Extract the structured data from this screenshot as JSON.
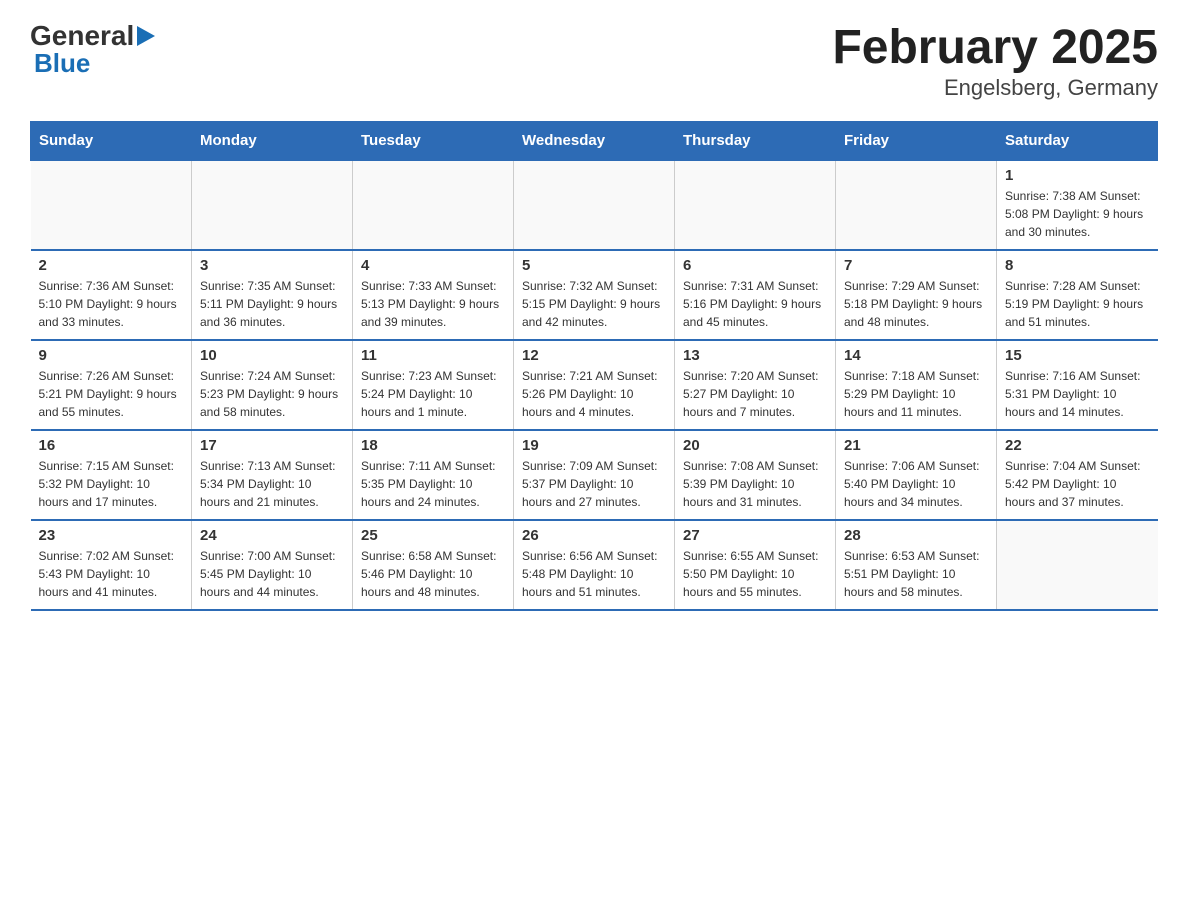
{
  "header": {
    "logo_general": "General",
    "logo_blue": "Blue",
    "title": "February 2025",
    "subtitle": "Engelsberg, Germany"
  },
  "weekdays": [
    "Sunday",
    "Monday",
    "Tuesday",
    "Wednesday",
    "Thursday",
    "Friday",
    "Saturday"
  ],
  "weeks": [
    [
      {
        "day": "",
        "info": ""
      },
      {
        "day": "",
        "info": ""
      },
      {
        "day": "",
        "info": ""
      },
      {
        "day": "",
        "info": ""
      },
      {
        "day": "",
        "info": ""
      },
      {
        "day": "",
        "info": ""
      },
      {
        "day": "1",
        "info": "Sunrise: 7:38 AM\nSunset: 5:08 PM\nDaylight: 9 hours and 30 minutes."
      }
    ],
    [
      {
        "day": "2",
        "info": "Sunrise: 7:36 AM\nSunset: 5:10 PM\nDaylight: 9 hours and 33 minutes."
      },
      {
        "day": "3",
        "info": "Sunrise: 7:35 AM\nSunset: 5:11 PM\nDaylight: 9 hours and 36 minutes."
      },
      {
        "day": "4",
        "info": "Sunrise: 7:33 AM\nSunset: 5:13 PM\nDaylight: 9 hours and 39 minutes."
      },
      {
        "day": "5",
        "info": "Sunrise: 7:32 AM\nSunset: 5:15 PM\nDaylight: 9 hours and 42 minutes."
      },
      {
        "day": "6",
        "info": "Sunrise: 7:31 AM\nSunset: 5:16 PM\nDaylight: 9 hours and 45 minutes."
      },
      {
        "day": "7",
        "info": "Sunrise: 7:29 AM\nSunset: 5:18 PM\nDaylight: 9 hours and 48 minutes."
      },
      {
        "day": "8",
        "info": "Sunrise: 7:28 AM\nSunset: 5:19 PM\nDaylight: 9 hours and 51 minutes."
      }
    ],
    [
      {
        "day": "9",
        "info": "Sunrise: 7:26 AM\nSunset: 5:21 PM\nDaylight: 9 hours and 55 minutes."
      },
      {
        "day": "10",
        "info": "Sunrise: 7:24 AM\nSunset: 5:23 PM\nDaylight: 9 hours and 58 minutes."
      },
      {
        "day": "11",
        "info": "Sunrise: 7:23 AM\nSunset: 5:24 PM\nDaylight: 10 hours and 1 minute."
      },
      {
        "day": "12",
        "info": "Sunrise: 7:21 AM\nSunset: 5:26 PM\nDaylight: 10 hours and 4 minutes."
      },
      {
        "day": "13",
        "info": "Sunrise: 7:20 AM\nSunset: 5:27 PM\nDaylight: 10 hours and 7 minutes."
      },
      {
        "day": "14",
        "info": "Sunrise: 7:18 AM\nSunset: 5:29 PM\nDaylight: 10 hours and 11 minutes."
      },
      {
        "day": "15",
        "info": "Sunrise: 7:16 AM\nSunset: 5:31 PM\nDaylight: 10 hours and 14 minutes."
      }
    ],
    [
      {
        "day": "16",
        "info": "Sunrise: 7:15 AM\nSunset: 5:32 PM\nDaylight: 10 hours and 17 minutes."
      },
      {
        "day": "17",
        "info": "Sunrise: 7:13 AM\nSunset: 5:34 PM\nDaylight: 10 hours and 21 minutes."
      },
      {
        "day": "18",
        "info": "Sunrise: 7:11 AM\nSunset: 5:35 PM\nDaylight: 10 hours and 24 minutes."
      },
      {
        "day": "19",
        "info": "Sunrise: 7:09 AM\nSunset: 5:37 PM\nDaylight: 10 hours and 27 minutes."
      },
      {
        "day": "20",
        "info": "Sunrise: 7:08 AM\nSunset: 5:39 PM\nDaylight: 10 hours and 31 minutes."
      },
      {
        "day": "21",
        "info": "Sunrise: 7:06 AM\nSunset: 5:40 PM\nDaylight: 10 hours and 34 minutes."
      },
      {
        "day": "22",
        "info": "Sunrise: 7:04 AM\nSunset: 5:42 PM\nDaylight: 10 hours and 37 minutes."
      }
    ],
    [
      {
        "day": "23",
        "info": "Sunrise: 7:02 AM\nSunset: 5:43 PM\nDaylight: 10 hours and 41 minutes."
      },
      {
        "day": "24",
        "info": "Sunrise: 7:00 AM\nSunset: 5:45 PM\nDaylight: 10 hours and 44 minutes."
      },
      {
        "day": "25",
        "info": "Sunrise: 6:58 AM\nSunset: 5:46 PM\nDaylight: 10 hours and 48 minutes."
      },
      {
        "day": "26",
        "info": "Sunrise: 6:56 AM\nSunset: 5:48 PM\nDaylight: 10 hours and 51 minutes."
      },
      {
        "day": "27",
        "info": "Sunrise: 6:55 AM\nSunset: 5:50 PM\nDaylight: 10 hours and 55 minutes."
      },
      {
        "day": "28",
        "info": "Sunrise: 6:53 AM\nSunset: 5:51 PM\nDaylight: 10 hours and 58 minutes."
      },
      {
        "day": "",
        "info": ""
      }
    ]
  ]
}
